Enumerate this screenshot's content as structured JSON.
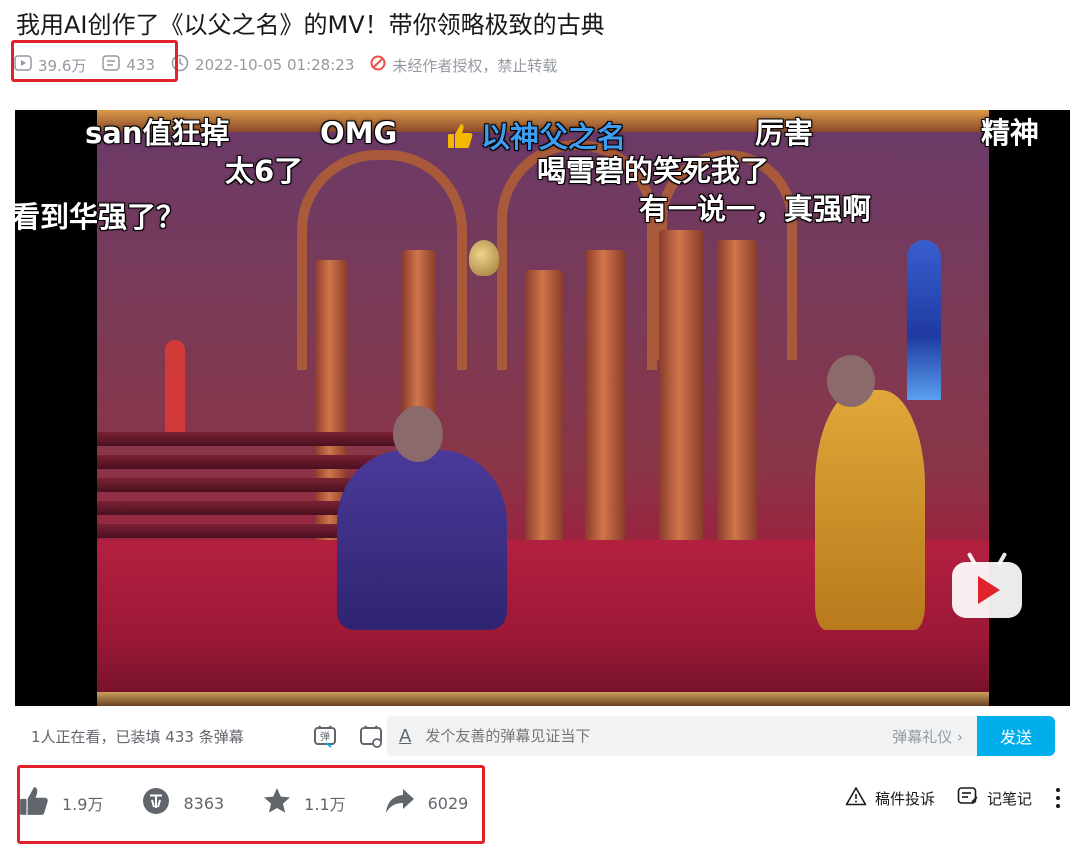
{
  "title": "我用AI创作了《以父之名》的MV！带你领略极致的古典",
  "meta": {
    "views": "39.6万",
    "danmaku_count": "433",
    "publish_time": "2022-10-05 01:28:23",
    "copyright_notice": "未经作者授权，禁止转载"
  },
  "danmaku": [
    {
      "text": "san值狂掉"
    },
    {
      "text": "OMG"
    },
    {
      "text": "以神父之名"
    },
    {
      "text": "厉害"
    },
    {
      "text": "精神"
    },
    {
      "text": "太6了"
    },
    {
      "text": "喝雪碧的笑死我了"
    },
    {
      "text": "看到华强了？"
    },
    {
      "text": "有一说一，真强啊"
    }
  ],
  "danmaku_bar": {
    "watching": "1人正在看，已装填 433 条弹幕",
    "input_placeholder": "发个友善的弹幕见证当下",
    "etiquette": "弹幕礼仪 ›",
    "send_label": "发送",
    "format_icon_label": "A"
  },
  "actions": {
    "like": "1.9万",
    "coin": "8363",
    "favorite": "1.1万",
    "share": "6029"
  },
  "right_tools": {
    "report": "稿件投诉",
    "notes": "记笔记"
  },
  "colors": {
    "accent": "#00aeec",
    "highlight_box": "#e0232b",
    "muted_text": "#9499a0"
  }
}
